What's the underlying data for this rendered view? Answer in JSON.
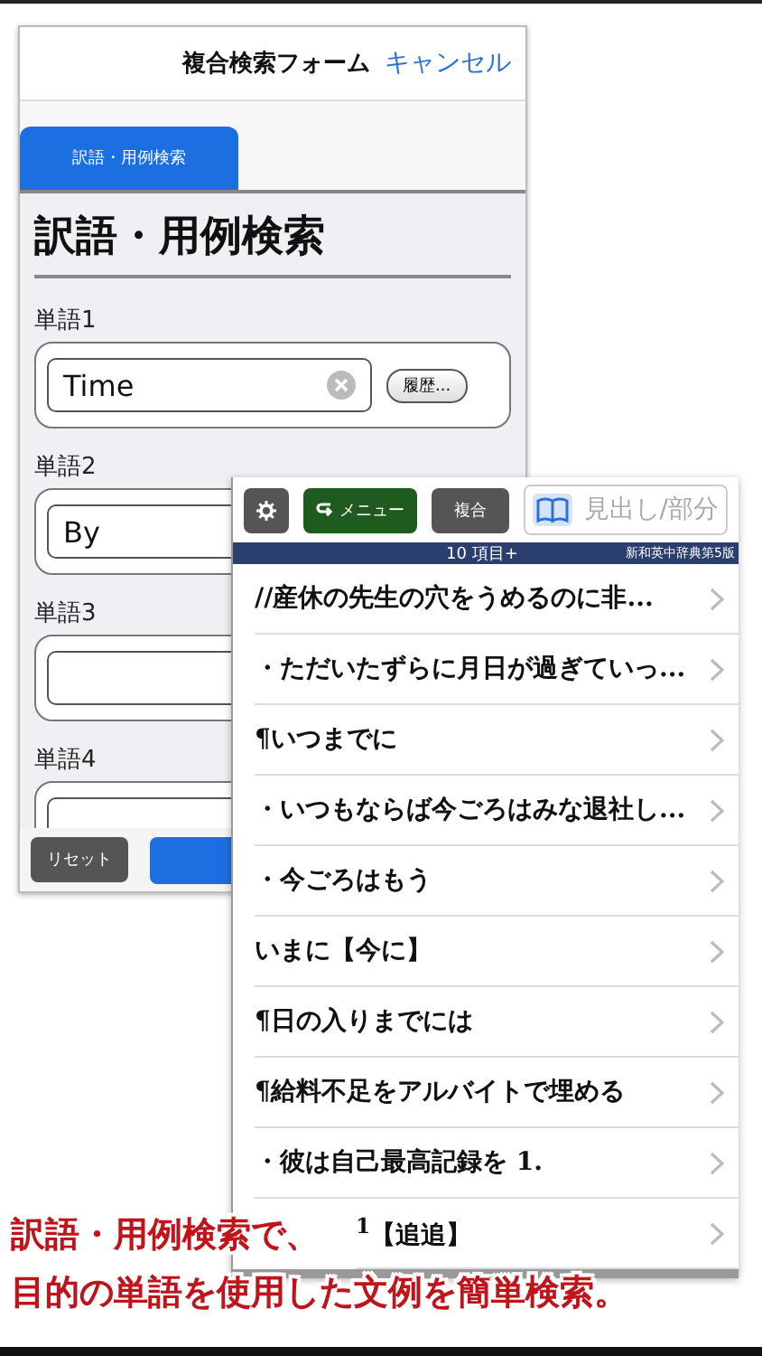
{
  "back_window": {
    "title": "複合検索フォーム",
    "cancel": "キャンセル",
    "tabs": [
      {
        "label": "訳語・用例検索",
        "selected": true
      }
    ],
    "heading": "訳語・用例検索",
    "fields": [
      {
        "label": "単語1",
        "value": "Time",
        "history": "履歴..."
      },
      {
        "label": "単語2",
        "value": "By"
      },
      {
        "label": "単語3"
      },
      {
        "label": "単語4"
      }
    ],
    "reset": "リセット"
  },
  "front_window": {
    "menu": "メニュー",
    "compound": "複合",
    "search": {
      "placeholder": "見出し/部分"
    },
    "count": "10 項目+",
    "dictionary": "新和英中辞典第5版",
    "rows": [
      "//産休の先生の穴をうめるのに非...",
      "・ただいたずらに月日が過ぎていっ...",
      "¶いつまでに",
      "・いつもならば今ごろはみな退社し...",
      "・今ごろはもう",
      "いまに【今に】",
      "¶日の入りまでには",
      "¶給料不足をアルバイトで埋める",
      "・彼は自己最高記録を 1.",
      "$^{1}$【追追】"
    ]
  },
  "caption": [
    "訳語・用例検索で、",
    "目的の単語を使用した文例を簡単検索。"
  ]
}
